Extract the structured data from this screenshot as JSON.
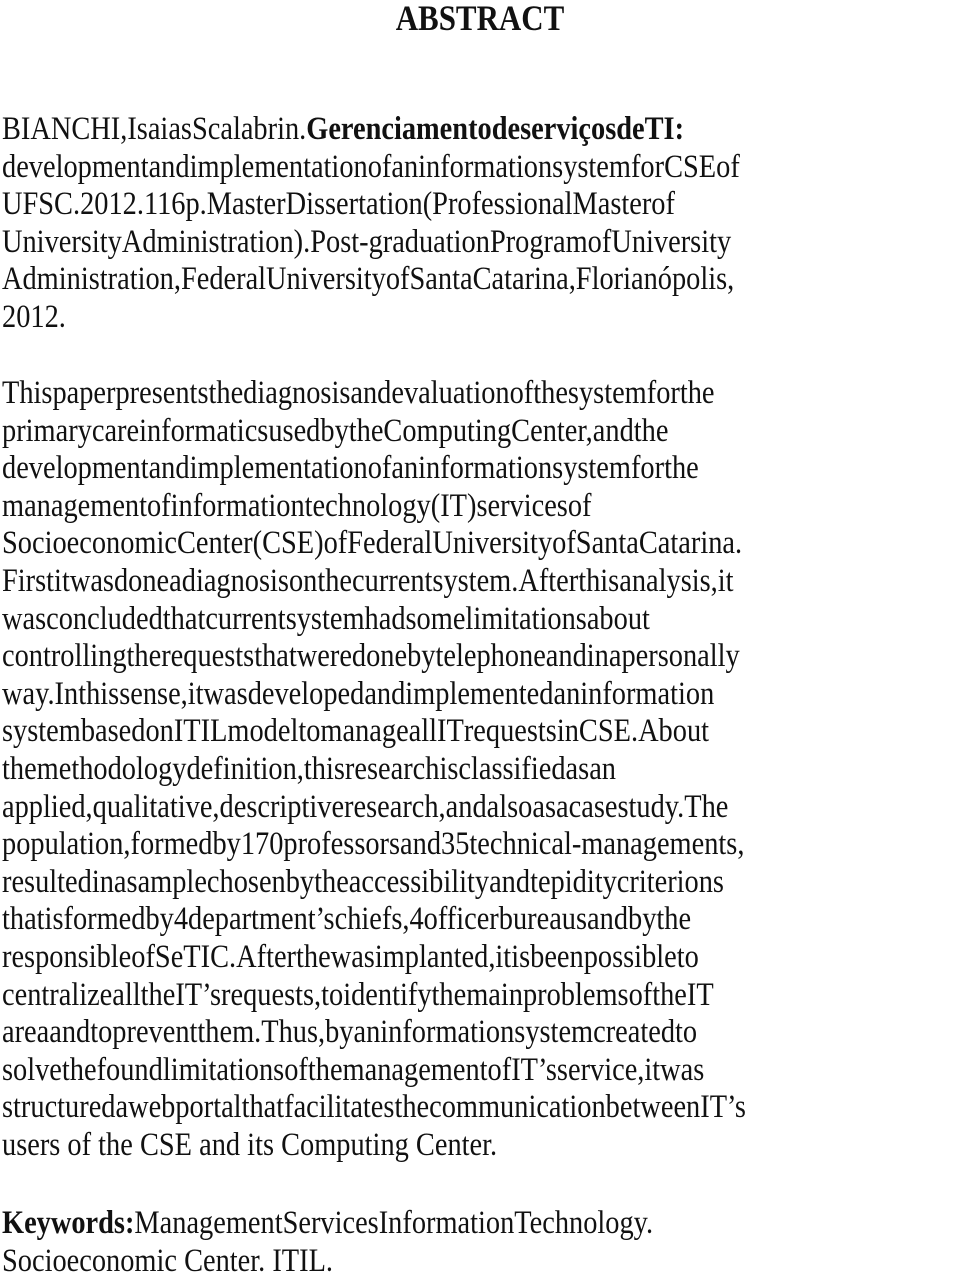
{
  "document": {
    "title": "ABSTRACT",
    "reference": {
      "author": "BIANCHI, Isaias Scalabrin.",
      "work_title": "Gerenciamento de serviços de TI",
      "lines": [
        {
          "segments": [
            {
              "text": "BIANCHI, Isaias Scalabrin. ",
              "bold": false
            },
            {
              "text": "Gerenciamento de serviços de TI",
              "bold": true
            },
            {
              "text": ":",
              "bold": false
            }
          ],
          "justify": true
        },
        {
          "segments": [
            {
              "text": "development and implementation of an information system for CSE of",
              "bold": false
            }
          ],
          "justify": true
        },
        {
          "segments": [
            {
              "text": "UFSC. 2012. 116p. Master Dissertation (Professional Master of",
              "bold": false
            }
          ],
          "justify": true
        },
        {
          "segments": [
            {
              "text": "University Administration). Post-graduation Program of University",
              "bold": false
            }
          ],
          "justify": true
        },
        {
          "segments": [
            {
              "text": "Administration, Federal University of Santa Catarina, Florianópolis,",
              "bold": false
            }
          ],
          "justify": true
        },
        {
          "segments": [
            {
              "text": "2012.",
              "bold": false
            }
          ],
          "justify": false
        }
      ]
    },
    "abstract_lines": [
      {
        "text": "This paper presents the diagnosis and evaluation of the system for the",
        "justify": true
      },
      {
        "text": "primary care informatics used by the Computing Center, and the",
        "justify": true
      },
      {
        "text": "development and implementation of an information system for the",
        "justify": true
      },
      {
        "text": "management of information technology (IT) services of",
        "justify": true
      },
      {
        "text": "Socioeconomic Center (CSE) of Federal University of Santa Catarina.",
        "justify": true
      },
      {
        "text": "First it was done a diagnosis on the current system. After this analysis, it",
        "justify": true
      },
      {
        "text": "was concluded that current system had some limitations about",
        "justify": true
      },
      {
        "text": "controlling the requests that were done by telephone and in a personally",
        "justify": true
      },
      {
        "text": "way. In this sense, it was developed and implemented an information",
        "justify": true
      },
      {
        "text": "system based on ITIL model to manage all IT requests in CSE. About",
        "justify": true
      },
      {
        "text": "the methodology definition, this research is classified as an",
        "justify": true
      },
      {
        "text": "applied, qualitative, descriptive research, and also as a case study. The",
        "justify": true
      },
      {
        "text": "population, formed by 170 professors and 35 technical-managements,",
        "justify": true
      },
      {
        "text": "resulted in a sample chosen by the accessibility and tepidity criterions",
        "justify": true
      },
      {
        "text": "that is formed by 4 department’s chiefs, 4 officer bureaus and by the",
        "justify": true
      },
      {
        "text": "responsible of SeTIC. After the was implanted, it is been possible to",
        "justify": true
      },
      {
        "text": "centralize all the IT’s requests, to identify the main problems of the IT",
        "justify": true
      },
      {
        "text": "area and to prevent them. Thus, by an information system created to",
        "justify": true
      },
      {
        "text": "solve the found limitations of the management of IT’s service, it was",
        "justify": true
      },
      {
        "text": "structured a web portal that facilitates the communication between IT’s",
        "justify": true
      },
      {
        "text": "users of the CSE and its Computing Center.",
        "justify": false
      }
    ],
    "keywords": {
      "label": "Keywords:",
      "lines": [
        {
          "text": "Management Services Information Technology.",
          "justify": true
        },
        {
          "text": "Socioeconomic Center.  ITIL.",
          "justify": false
        }
      ]
    }
  }
}
